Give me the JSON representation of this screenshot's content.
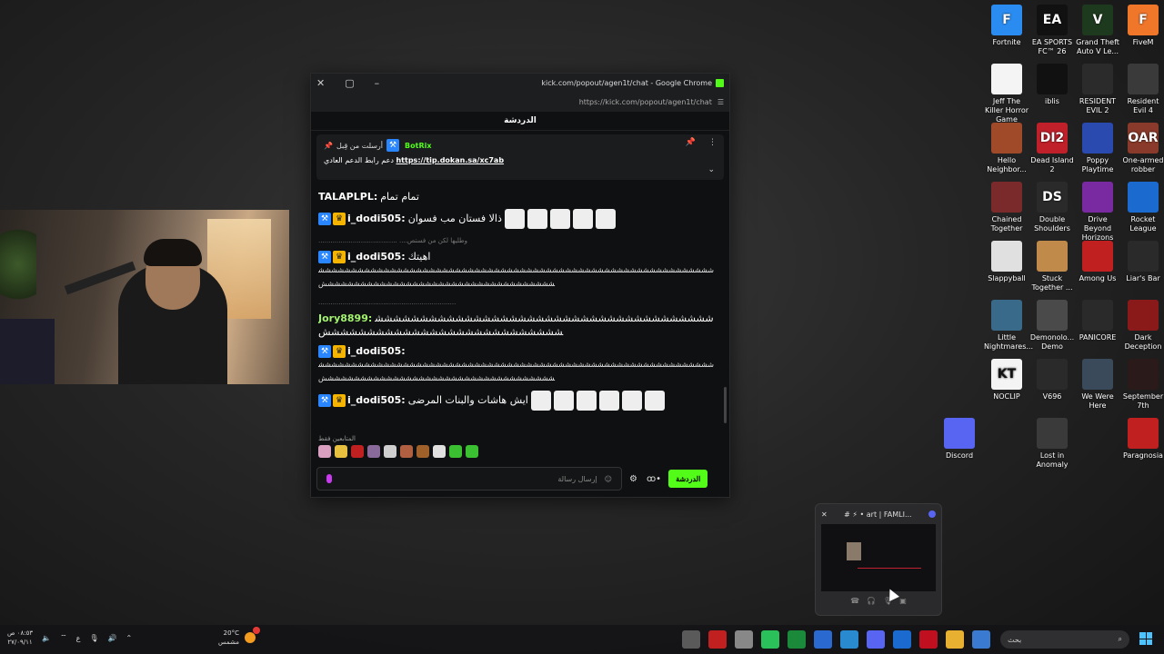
{
  "desktop_icons": [
    {
      "label": "Fortnite",
      "color": "#2a8cf0",
      "glyph": "F"
    },
    {
      "label": "EA SPORTS FC™ 26",
      "color": "#111111",
      "glyph": "EA"
    },
    {
      "label": "Grand Theft Auto V Le...",
      "color": "#1e3a1e",
      "glyph": "V"
    },
    {
      "label": "FiveM",
      "color": "#f0762a",
      "glyph": "F"
    },
    {
      "label": "Jeff The Killer Horror Game",
      "color": "#f4f4f4",
      "glyph": ""
    },
    {
      "label": "iblis",
      "color": "#111111",
      "glyph": ""
    },
    {
      "label": "RESIDENT EVIL 2",
      "color": "#2b2b2b",
      "glyph": ""
    },
    {
      "label": "Resident Evil 4",
      "color": "#3a3a3a",
      "glyph": ""
    },
    {
      "label": "Hello Neighbor...",
      "color": "#a04a2a",
      "glyph": ""
    },
    {
      "label": "Dead Island 2",
      "color": "#c0202a",
      "glyph": "DI2"
    },
    {
      "label": "Poppy Playtime",
      "color": "#2a4ab0",
      "glyph": ""
    },
    {
      "label": "One-armed robber",
      "color": "#8a3a2a",
      "glyph": "OAR"
    },
    {
      "label": "Chained Together",
      "color": "#7a2a2a",
      "glyph": ""
    },
    {
      "label": "Double Shoulders",
      "color": "#2a2a2a",
      "glyph": "DS"
    },
    {
      "label": "Drive Beyond Horizons D...",
      "color": "#7a2aa0",
      "glyph": ""
    },
    {
      "label": "Rocket League",
      "color": "#1a6ad0",
      "glyph": ""
    },
    {
      "label": "Slappyball",
      "color": "#e0e0e0",
      "glyph": ""
    },
    {
      "label": "Stuck Together ...",
      "color": "#c08a4a",
      "glyph": ""
    },
    {
      "label": "Among Us",
      "color": "#c02020",
      "glyph": ""
    },
    {
      "label": "Liar's Bar",
      "color": "#2a2a2a",
      "glyph": ""
    },
    {
      "label": "Little Nightmares...",
      "color": "#3a6a8a",
      "glyph": ""
    },
    {
      "label": "Demonolo... Demo",
      "color": "#4a4a4a",
      "glyph": ""
    },
    {
      "label": "PANICORE",
      "color": "#2a2a2a",
      "glyph": ""
    },
    {
      "label": "Dark Deception",
      "color": "#8a1a1a",
      "glyph": ""
    },
    {
      "label": "NOCLIP",
      "color": "#f4f4f4",
      "glyph": "KT"
    },
    {
      "label": "V696",
      "color": "#2a2a2a",
      "glyph": ""
    },
    {
      "label": "We Were Here",
      "color": "#3a4a5a",
      "glyph": ""
    },
    {
      "label": "September 7th",
      "color": "#2a1a1a",
      "glyph": ""
    },
    {
      "label": "Discord",
      "color": "#5865f2",
      "glyph": ""
    },
    {
      "label": "Lost in Anomaly",
      "color": "#3a3a3a",
      "glyph": ""
    },
    {
      "label": "Paragnosia",
      "color": "#c02020",
      "glyph": ""
    }
  ],
  "chrome": {
    "title": "kick.com/popout/agen1t/chat - Google Chrome",
    "url": "https://kick.com/popout/agen1t/chat",
    "chat_header": "الدردشة"
  },
  "pinned": {
    "sender_prefix": "أرسلت من قِبل",
    "bot_name": "BotRix",
    "text": "دعم رابط الدعم العادي",
    "link": "https://tip.dokan.sa/xc7ab"
  },
  "messages": [
    {
      "user": "TALAPLPL:",
      "user_class": "u-white",
      "text": "تمام تمام",
      "badges": false,
      "emotes": 0
    },
    {
      "user": "i_dodi505:",
      "user_class": "u-white",
      "text": "ذالا فستان مب فسوان",
      "badges": true,
      "emotes": 5
    },
    {
      "reply": "....................................... ....وطليها لكن من فستص",
      "user": "i_dodi505:",
      "user_class": "u-white",
      "text": "اهيتك",
      "badges": true,
      "emotes": 0,
      "hash": "ششششششششششششششششششششششششششششششششششششششششششششششششششششششششششششششششششششششششششششششششششششششششششششششششش"
    },
    {
      "reply": "....................................................................",
      "user": "Jory8899:",
      "user_class": "u-green",
      "text": "ششششششششششششششششششششششششششششششششششششششششششششششششششششششششششششششششش",
      "badges": false,
      "emotes": 0
    },
    {
      "user": "i_dodi505:",
      "user_class": "u-white",
      "text": "",
      "badges": true,
      "emotes": 0,
      "hash": "ششششششششششششششششششششششششششششششششششششششششششششششششششششششششششششششششششششششششششششششششششششششششششششششششش"
    },
    {
      "user": "i_dodi505:",
      "user_class": "u-white",
      "text": "ايش هاشات والبنات المرضى",
      "badges": true,
      "emotes": 6
    }
  ],
  "emote_bar_label": "المتابعين فقط",
  "input": {
    "placeholder": "إرسال رسالة",
    "send_label": "الدردشة"
  },
  "discord_popup": {
    "title": "# ⚡ • art | FAMLI..."
  },
  "taskbar": {
    "time": "٠٨:٥٣ ص",
    "date": "٢٧/٠٩/١١",
    "lang": "ع",
    "temp": "20°C",
    "weather": "مشمس",
    "search_placeholder": "بحث"
  }
}
